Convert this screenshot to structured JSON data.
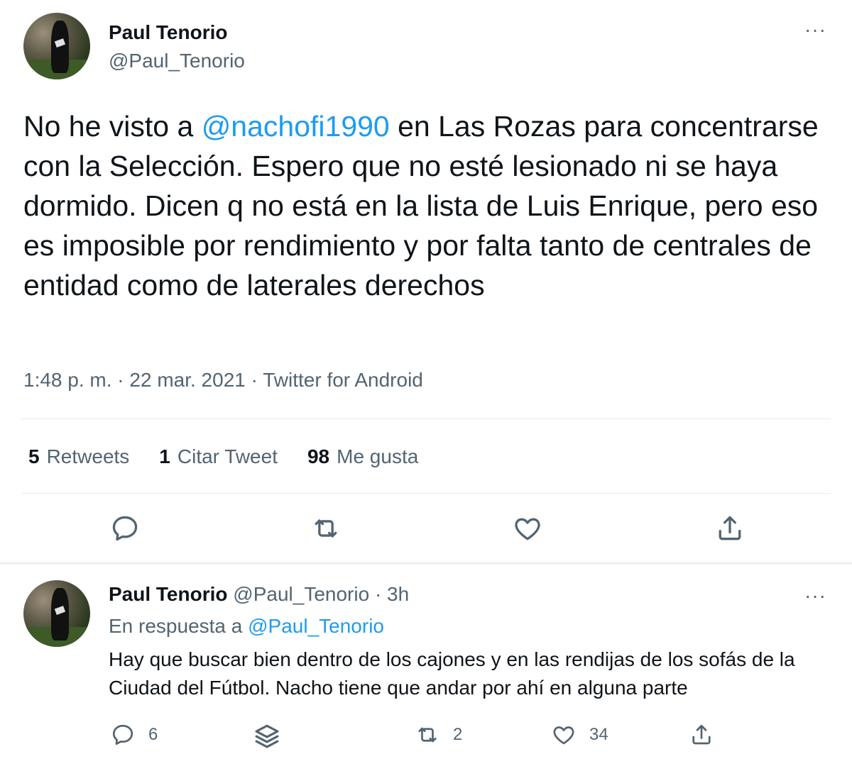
{
  "main_tweet": {
    "author_name": "Paul Tenorio",
    "author_handle": "@Paul_Tenorio",
    "more_label": "···",
    "text_before": "No he visto a ",
    "mention": "@nachofi1990",
    "text_after": " en Las Rozas para concentrarse con la Selección. Espero que no esté lesionado ni se haya dormido. Dicen q no está en la lista de Luis Enrique, pero eso es imposible por rendimiento y por falta tanto de centrales de entidad como de laterales derechos",
    "meta": "1:48 p. m. · 22 mar. 2021 · Twitter for Android",
    "stats": [
      {
        "count": "5",
        "label": "Retweets"
      },
      {
        "count": "1",
        "label": "Citar Tweet"
      },
      {
        "count": "98",
        "label": "Me gusta"
      }
    ],
    "actions": [
      "reply-icon",
      "retweet-icon",
      "like-icon",
      "share-icon"
    ]
  },
  "reply_tweet": {
    "author_name": "Paul Tenorio",
    "author_handle": "@Paul_Tenorio",
    "time": "· 3h",
    "more_label": "···",
    "reply_prefix": "En respuesta a ",
    "reply_to": "@Paul_Tenorio",
    "text": "Hay que buscar bien dentro de los cajones y en las rendijas de los sofás de la Ciudad del Fútbol. Nacho tiene que andar por ahí en alguna parte",
    "counts": {
      "replies": "6",
      "retweets": "2",
      "likes": "34"
    },
    "actions": [
      "reply-icon",
      "stack-icon",
      "retweet-icon",
      "like-icon",
      "share-icon"
    ]
  },
  "colors": {
    "link": "#1d9bf0",
    "secondary": "#536471",
    "text": "#0f1419"
  }
}
